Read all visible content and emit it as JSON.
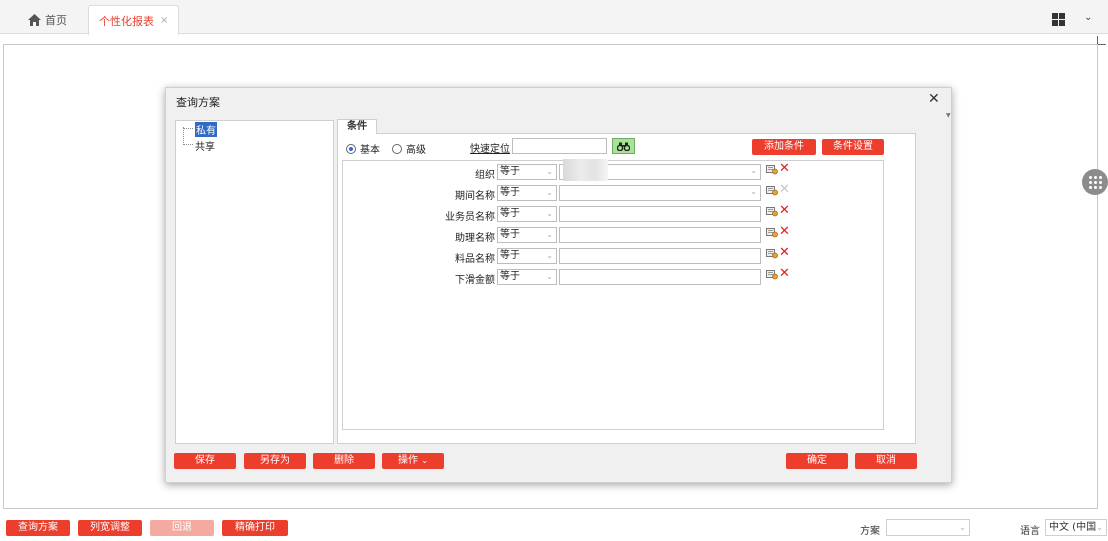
{
  "tabs": {
    "home_label": "首页",
    "active_label": "个性化报表",
    "close_glyph": "×"
  },
  "dialog": {
    "title": "查询方案",
    "close_glyph": "✕",
    "tree": {
      "private": "私有",
      "shared": "共享"
    },
    "conditions_tab": "条件",
    "mode_basic": "基本",
    "mode_advanced": "高级",
    "quick_locate_label": "快速定位",
    "quick_locate_value": "",
    "find_glyph": "👓",
    "add_condition": "添加条件",
    "condition_settings": "条件设置",
    "rows": [
      {
        "label": "组织",
        "operator": "等于",
        "value": "",
        "has_dropdown": true,
        "dim_delete": false
      },
      {
        "label": "期间名称",
        "operator": "等于",
        "value": "",
        "has_dropdown": true,
        "dim_delete": true
      },
      {
        "label": "业务员名称",
        "operator": "等于",
        "value": "",
        "has_dropdown": false,
        "dim_delete": false
      },
      {
        "label": "助理名称",
        "operator": "等于",
        "value": "",
        "has_dropdown": false,
        "dim_delete": false
      },
      {
        "label": "料品名称",
        "operator": "等于",
        "value": "",
        "has_dropdown": false,
        "dim_delete": false
      },
      {
        "label": "下滑金额",
        "operator": "等于",
        "value": "",
        "has_dropdown": false,
        "dim_delete": false
      }
    ],
    "buttons": {
      "save": "保存",
      "save_as": "另存为",
      "delete": "删除",
      "operations": "操作",
      "confirm": "确定",
      "cancel": "取消"
    }
  },
  "footer": {
    "query_scheme": "查询方案",
    "column_width": "列宽调整",
    "rollback": "回退",
    "precise_print": "精确打印",
    "scheme_label": "方案",
    "scheme_value": "",
    "language_label": "语言",
    "language_value": "中文 (中国"
  },
  "colors": {
    "accent_red": "#ec3d2d",
    "disabled_red": "#f4a9a1",
    "tree_selected": "#316ac5",
    "find_button": "#a8e29a"
  }
}
